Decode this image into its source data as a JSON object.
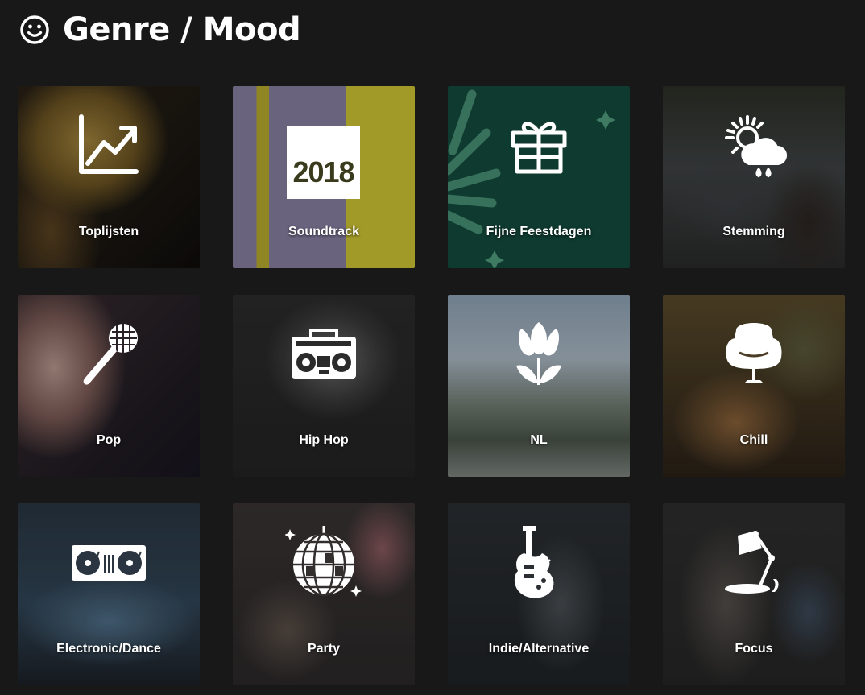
{
  "header": {
    "title": "Genre / Mood",
    "icon": "smiley-icon"
  },
  "tiles": [
    {
      "label": "Toplijsten",
      "icon": "chart-trending-icon"
    },
    {
      "label": "Soundtrack",
      "icon": "year-badge-icon",
      "badge": "2018"
    },
    {
      "label": "Fijne Feestdagen",
      "icon": "gift-icon"
    },
    {
      "label": "Stemming",
      "icon": "weather-sun-cloud-icon"
    },
    {
      "label": "Pop",
      "icon": "microphone-icon"
    },
    {
      "label": "Hip Hop",
      "icon": "boombox-icon"
    },
    {
      "label": "NL",
      "icon": "tulip-icon"
    },
    {
      "label": "Chill",
      "icon": "egg-chair-icon"
    },
    {
      "label": "Electronic/Dance",
      "icon": "dj-turntables-icon"
    },
    {
      "label": "Party",
      "icon": "disco-ball-icon"
    },
    {
      "label": "Indie/Alternative",
      "icon": "electric-guitar-icon"
    },
    {
      "label": "Focus",
      "icon": "desk-lamp-icon"
    }
  ],
  "colors": {
    "background": "#181818",
    "text": "#ffffff"
  }
}
